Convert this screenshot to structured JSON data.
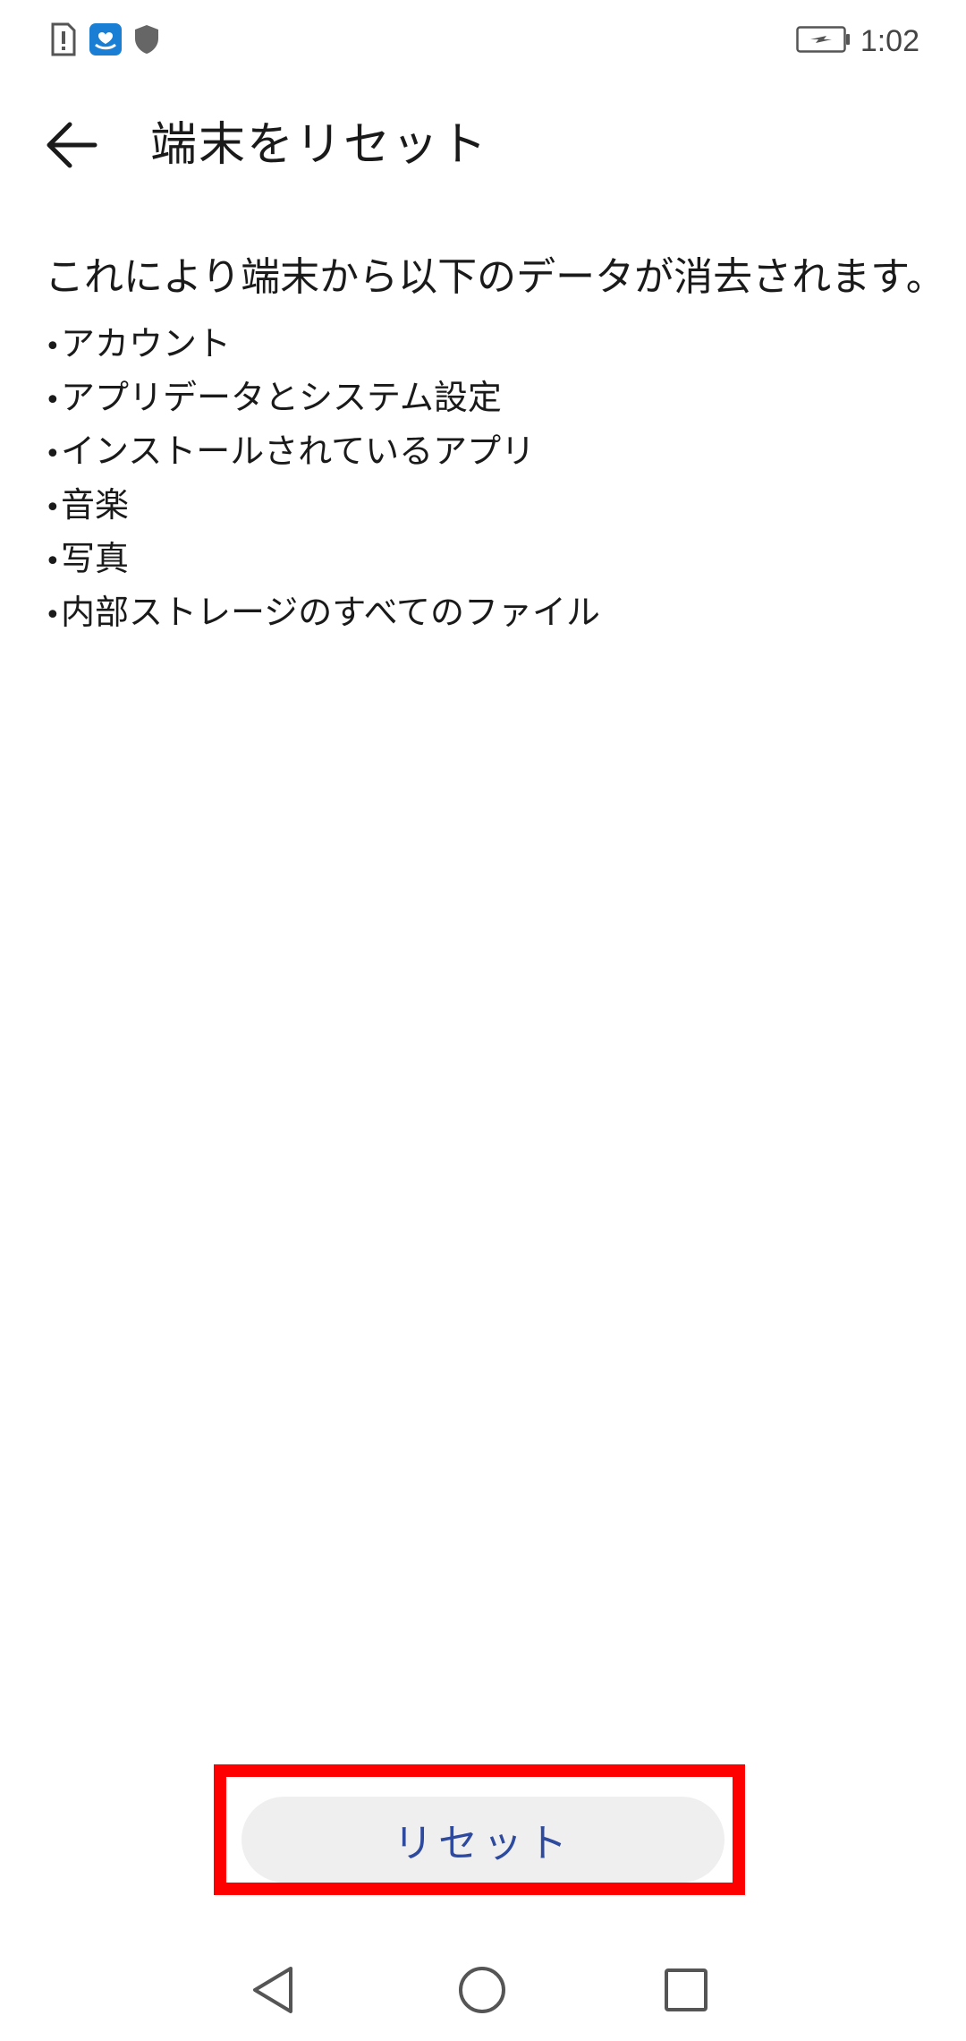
{
  "status_bar": {
    "time": "1:02",
    "left_icons": [
      "sim-alert-icon",
      "app-notification-icon",
      "shield-icon"
    ],
    "right_icons": [
      "battery-charging-icon"
    ]
  },
  "header": {
    "title": "端末をリセット"
  },
  "content": {
    "intro": "これにより端末から以下のデータが消去されます。",
    "bullet": "•",
    "items": [
      "アカウント",
      "アプリデータとシステム設定",
      "インストールされているアプリ",
      "音楽",
      "写真",
      "内部ストレージのすべてのファイル"
    ]
  },
  "actions": {
    "reset_label": "リセット"
  },
  "navigation": {
    "icons": [
      "back-triangle-icon",
      "home-circle-icon",
      "recents-square-icon"
    ]
  },
  "colors": {
    "accent": "#2d4a9e",
    "button_bg": "#efeff0",
    "highlight": "#ff0000"
  }
}
